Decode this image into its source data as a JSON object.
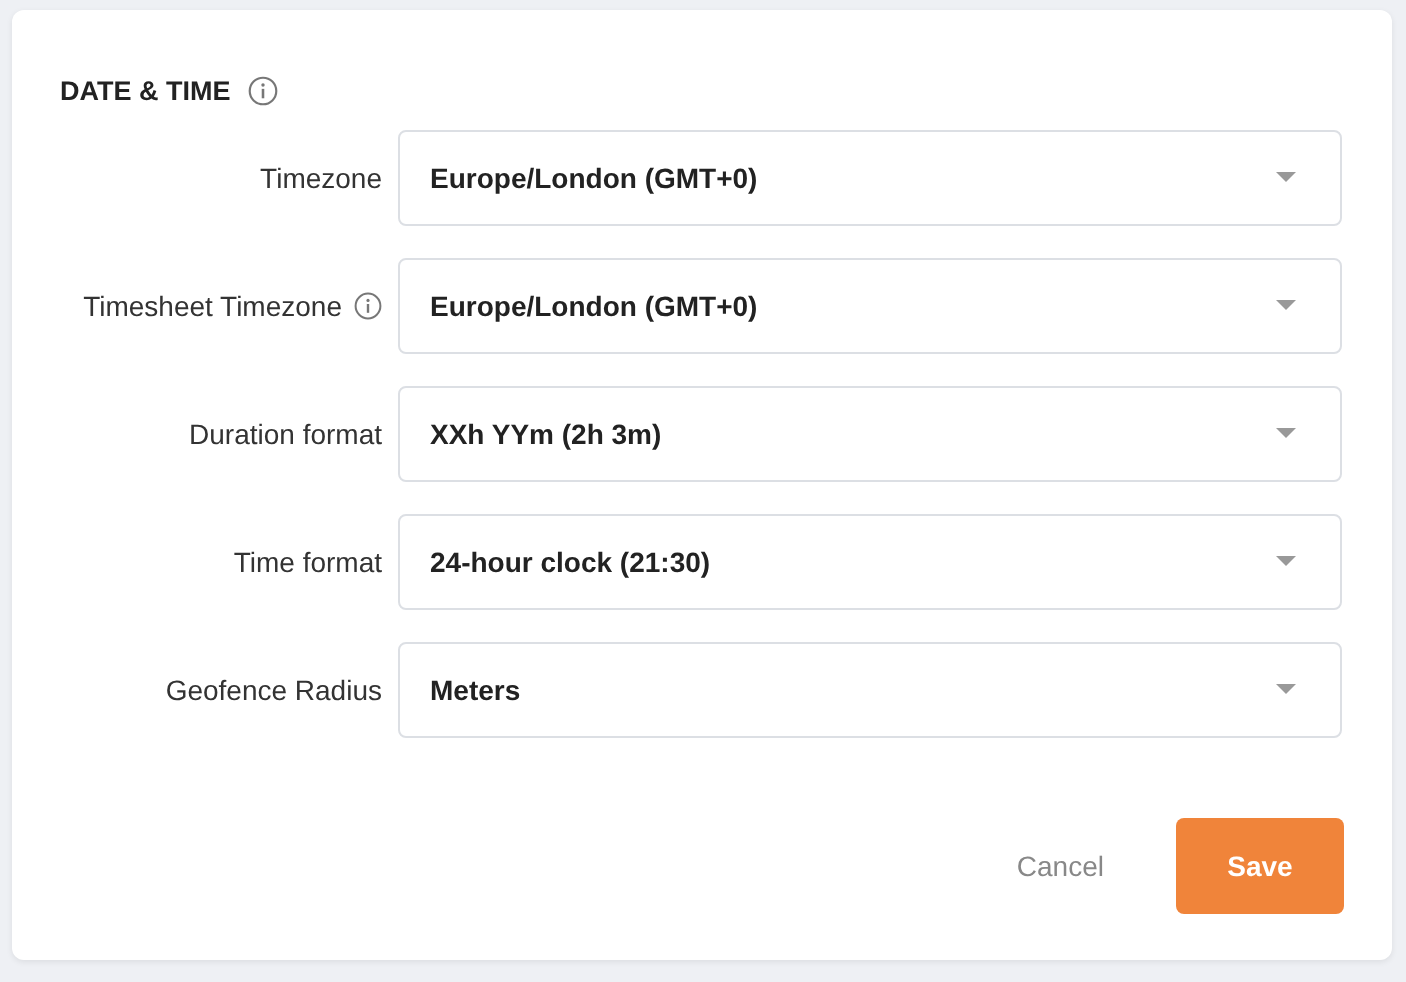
{
  "section": {
    "title": "DATE & TIME",
    "info": true
  },
  "fields": [
    {
      "label": "Timezone",
      "info": false,
      "value": "Europe/London (GMT+0)"
    },
    {
      "label": "Timesheet Timezone",
      "info": true,
      "value": "Europe/London (GMT+0)"
    },
    {
      "label": "Duration format",
      "info": false,
      "value": "XXh YYm (2h 3m)"
    },
    {
      "label": "Time format",
      "info": false,
      "value": "24-hour clock (21:30)"
    },
    {
      "label": "Geofence Radius",
      "info": false,
      "value": "Meters"
    }
  ],
  "buttons": {
    "cancel": "Cancel",
    "save": "Save"
  }
}
